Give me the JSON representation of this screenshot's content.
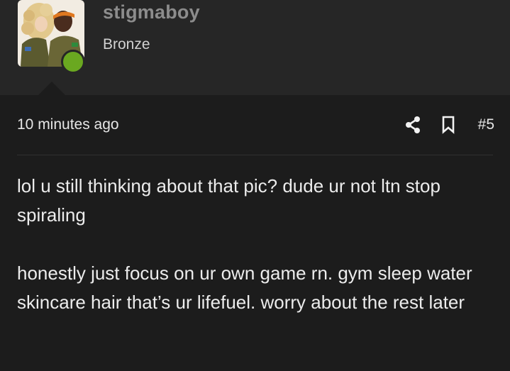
{
  "post": {
    "author": {
      "username": "stigmaboy",
      "rank": "Bronze",
      "online": true,
      "avatar_icon": "avatar-illustration",
      "online_color": "#6aa820"
    },
    "timestamp": "10 minutes ago",
    "post_number": "#5",
    "actions": {
      "share_icon": "share-icon",
      "bookmark_icon": "bookmark-icon"
    },
    "body": {
      "paragraph_1": "lol u still thinking about that pic? dude ur not ltn stop spiraling",
      "paragraph_2": "honestly just focus on ur own game rn. gym sleep water skincare hair that’s ur lifefuel. worry about the rest later"
    }
  },
  "colors": {
    "background": "#1c1c1c",
    "header_background": "#262626",
    "username": "#8c8c8c",
    "text": "#ececec"
  }
}
